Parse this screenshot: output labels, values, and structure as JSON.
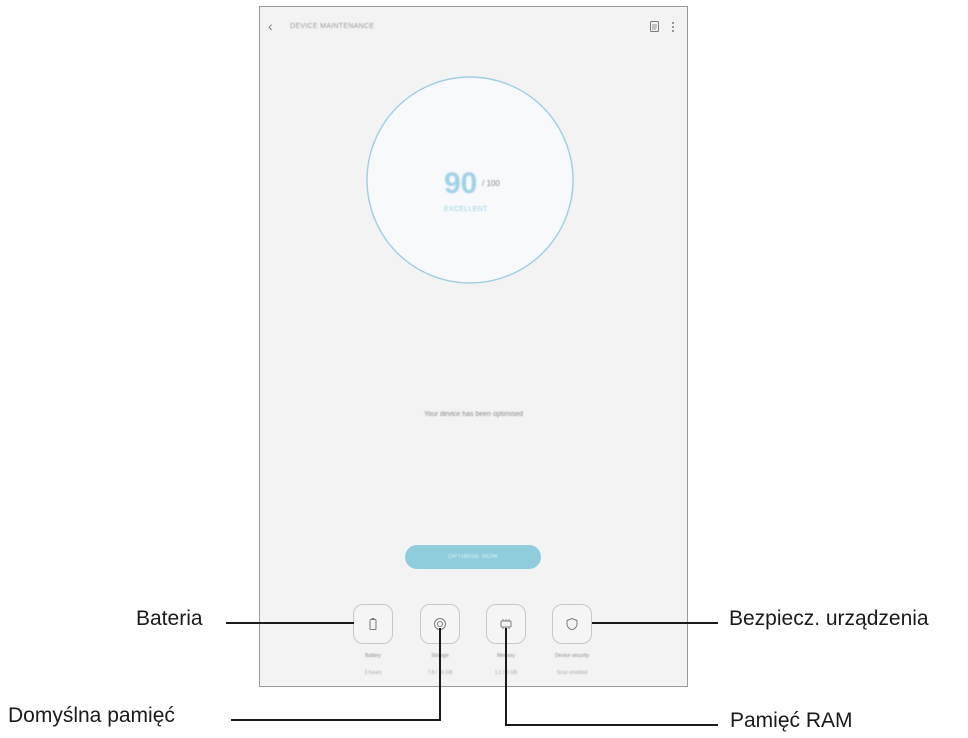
{
  "header": {
    "title": "DEVICE MAINTENANCE",
    "back_icon": "back-chevron-icon",
    "doc_icon": "document-icon",
    "more_icon": "more-vertical-icon"
  },
  "score": {
    "value": "90",
    "max": "/ 100",
    "status": "EXCELLENT"
  },
  "status_message": "Your device has been optimised",
  "optimize_button": "OPTIMISE NOW",
  "tiles": [
    {
      "name": "Battery",
      "sub": "3 hours",
      "icon": "battery-icon"
    },
    {
      "name": "Storage",
      "sub": "7.8 / 16 GB",
      "icon": "storage-icon"
    },
    {
      "name": "Memory",
      "sub": "1.1 / 2 GB",
      "icon": "memory-chip-icon"
    },
    {
      "name": "Device security",
      "sub": "Scan enabled",
      "icon": "shield-icon"
    }
  ],
  "callouts": {
    "battery": "Bateria",
    "storage": "Domyślna pamięć",
    "memory": "Pamięć RAM",
    "security": "Bezpiecz. urządzenia"
  },
  "colors": {
    "accent": "#8fcddd",
    "ring": "#9fcfe2",
    "screen_bg": "#f3f3f3"
  }
}
